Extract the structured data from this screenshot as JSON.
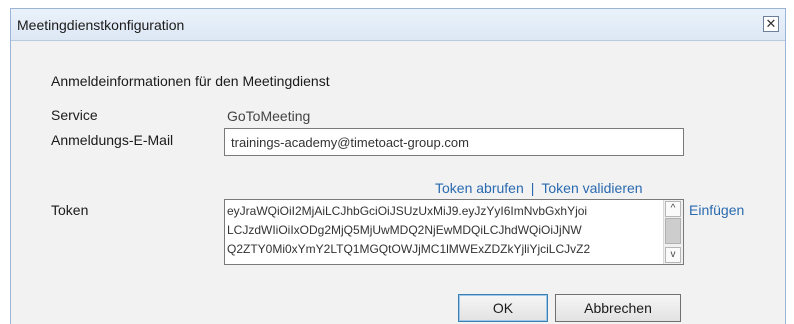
{
  "window": {
    "title": "Meetingdienstkonfiguration",
    "close_glyph": "✕"
  },
  "section_heading": "Anmeldeinformationen für den Meetingdienst",
  "service": {
    "label": "Service",
    "value": "GoToMeeting"
  },
  "email": {
    "label": "Anmeldungs-E-Mail",
    "value": "trainings-academy@timetoact-group.com"
  },
  "token_links": {
    "fetch": "Token abrufen",
    "separator": "|",
    "validate": "Token validieren"
  },
  "token": {
    "label": "Token",
    "lines": [
      "eyJraWQiOiI2MjAiLCJhbGciOiJSUzUxMiJ9.eyJzYyI6ImNvbGxhYjoi",
      "LCJzdWIiOiIxODg2MjQ5MjUwMDQ2NjEwMDQiLCJhdWQiOiJjNW",
      "Q2ZTY0Mi0xYmY2LTQ1MGQtOWJjMC1lMWExZDZkYjliYjciLCJvZ2"
    ],
    "paste_label": "Einfügen",
    "scroll_up_glyph": "^",
    "scroll_down_glyph": "v"
  },
  "buttons": {
    "ok": "OK",
    "cancel": "Abbrechen"
  }
}
